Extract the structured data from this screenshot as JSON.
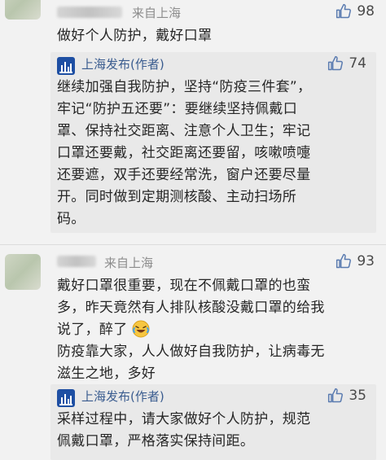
{
  "comments": [
    {
      "location": "来自上海",
      "likes": "98",
      "text": "做好个人防护，戴好口罩",
      "reply": {
        "author": "上海发布(作者)",
        "likes": "74",
        "lines": [
          "继续加强自我防护，坚持“防疫三件套”，",
          "牢记“防护五还要”：要继续坚持佩戴口",
          "罩、保持社交距离、注意个人卫生；牢记",
          "口罩还要戴，社交距离还要留，咳嗽喷嚏",
          "还要遮，双手还要经常洗，窗户还要尽量",
          "开。同时做到定期测核酸、主动扫场所",
          "码。"
        ]
      }
    },
    {
      "location": "来自上海",
      "likes": "93",
      "lines": [
        "戴好口罩很重要，现在不佩戴口罩的也蛮",
        "多，昨天竟然有人排队核酸没戴口罩的给我",
        "说了，醉了",
        "防疫靠大家，人人做好自我防护，让病毒无",
        "滋生之地，多好"
      ],
      "reply": {
        "author": "上海发布(作者)",
        "likes": "35",
        "lines": [
          "采样过程中，请大家做好个人防护，规范",
          "佩戴口罩，严格落实保持间距。"
        ]
      }
    }
  ],
  "colors": {
    "background": "#f2f2f2",
    "reply_background": "#e9e9e9",
    "author_blue": "#3a5c8f",
    "logo_blue": "#1e4fa3",
    "like_icon": "#5a7bb0"
  },
  "icons": {
    "like": "thumbs-up-icon",
    "emoji": "laughing-crying-emoji-icon",
    "logo": "shanghai-fabu-logo-icon"
  }
}
